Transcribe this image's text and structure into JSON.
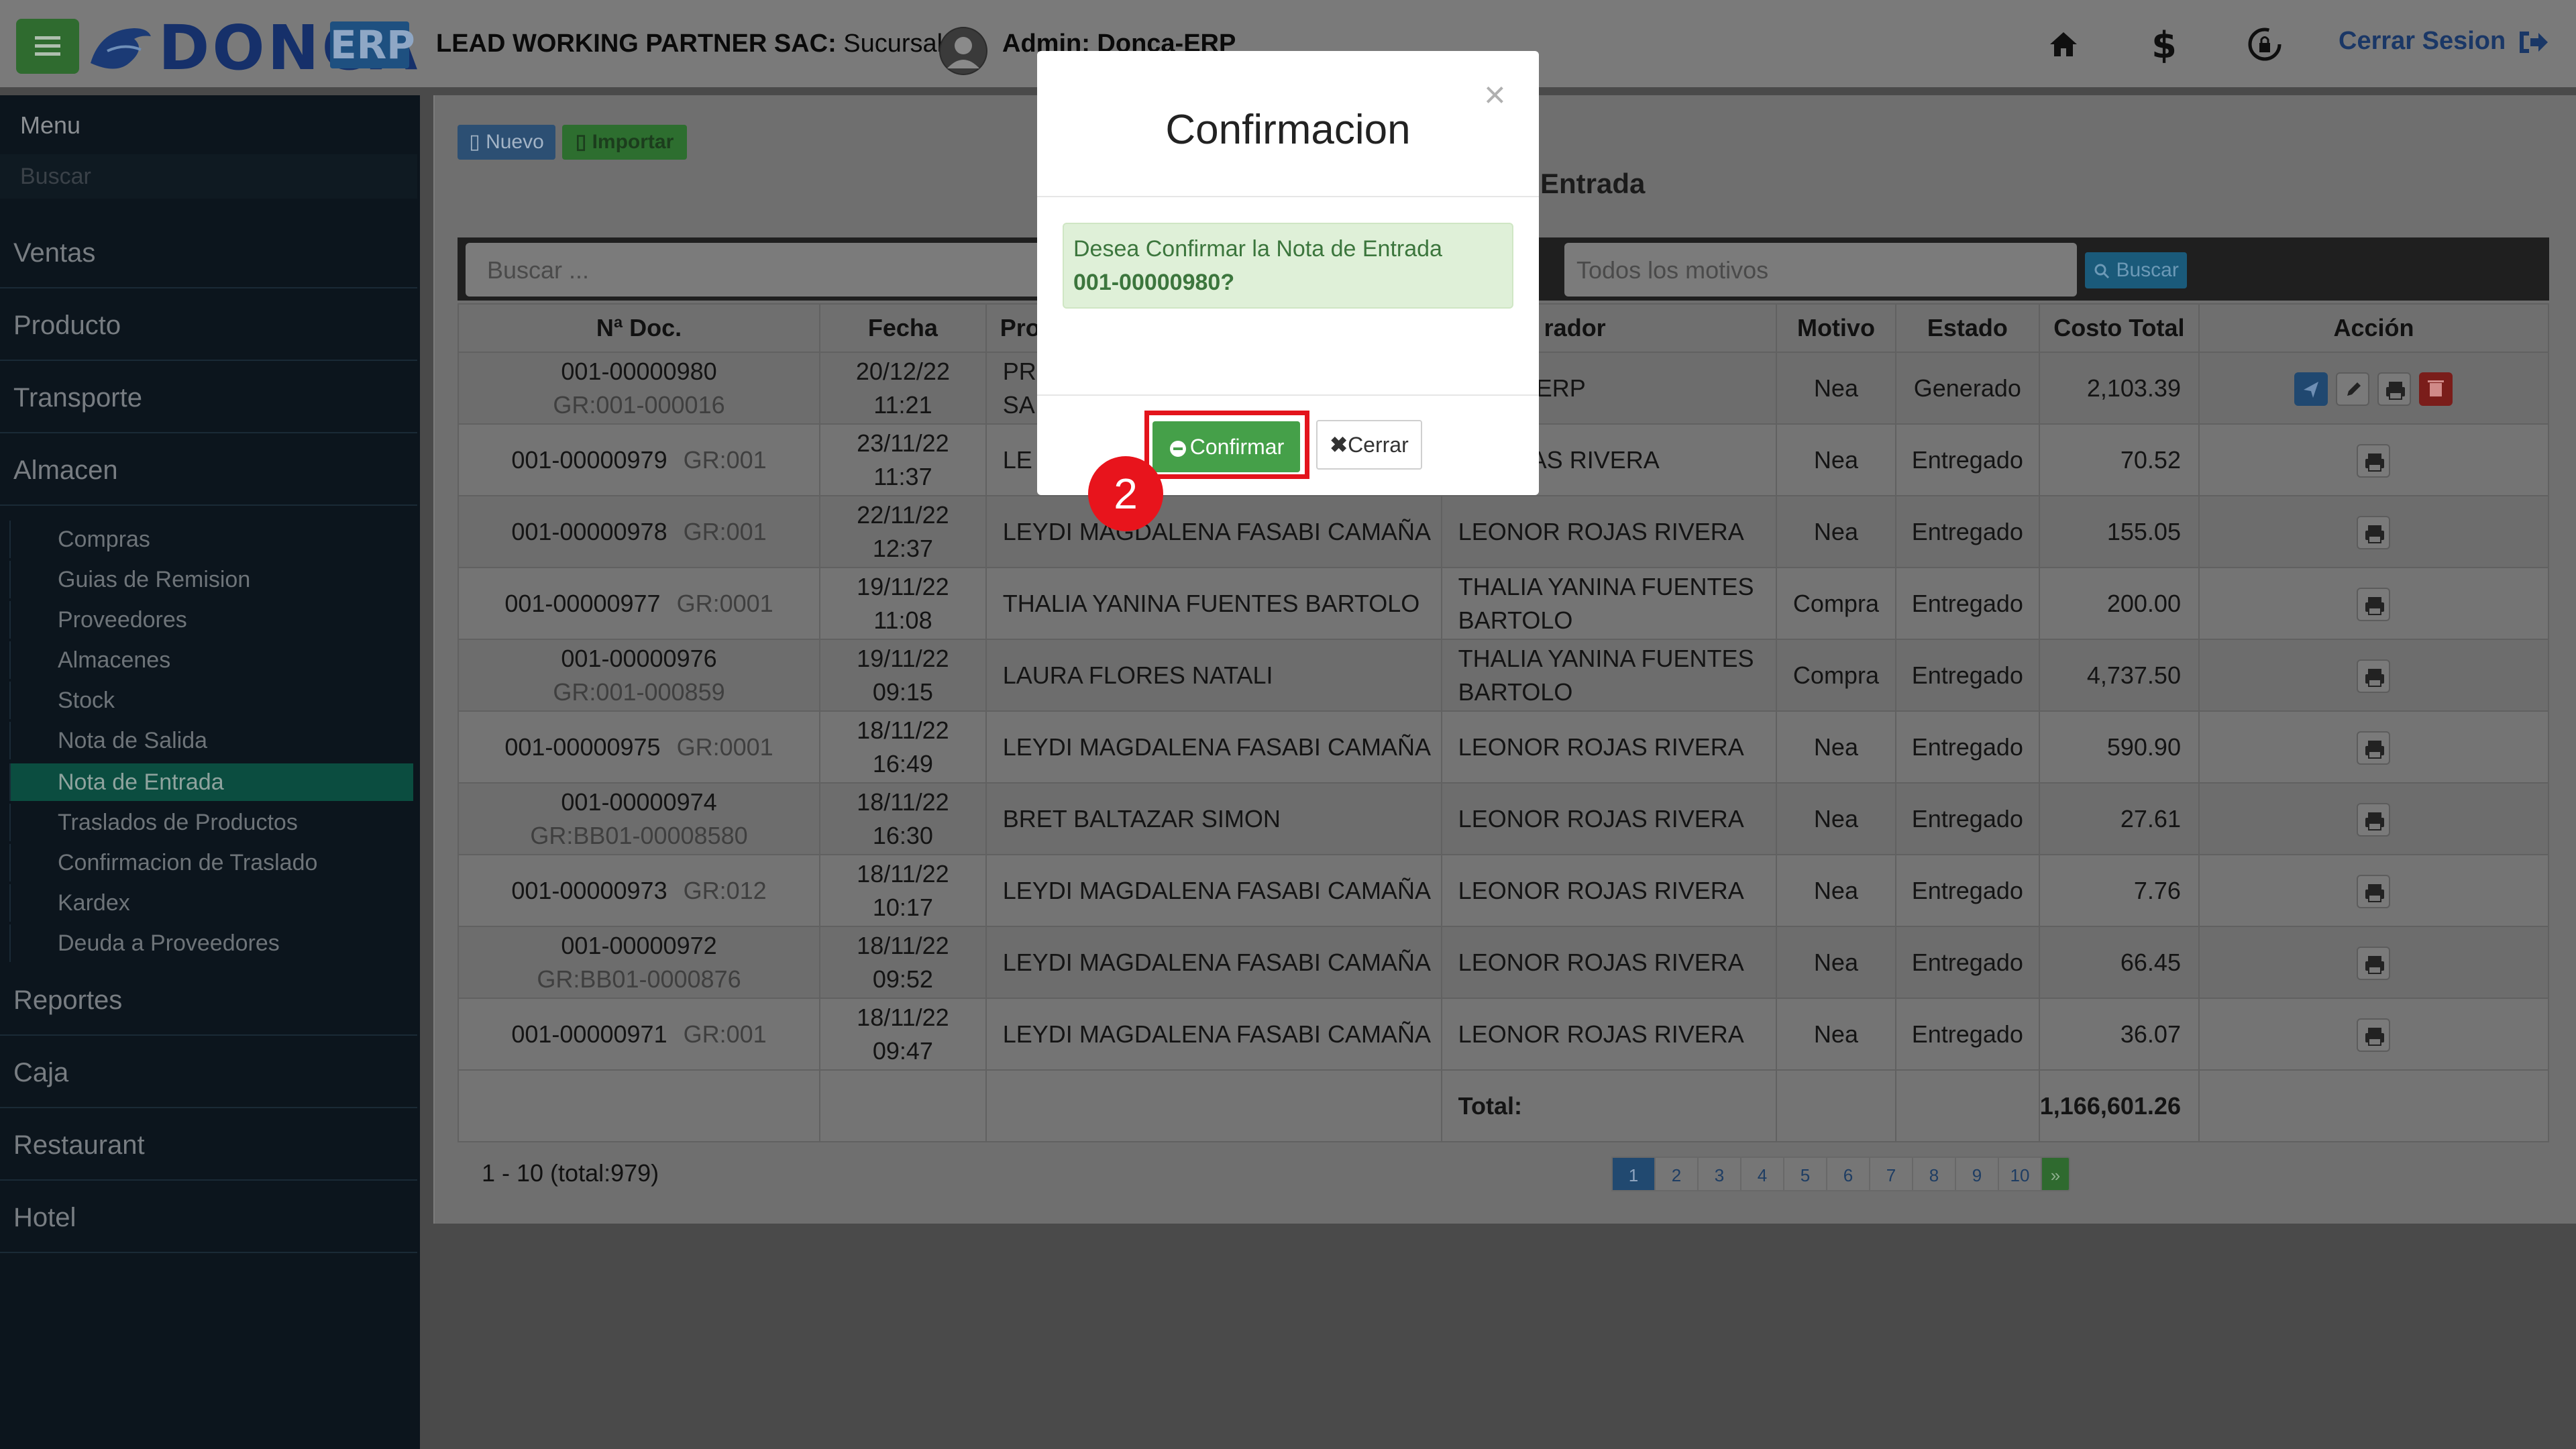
{
  "header": {
    "logo_text": "DONCA",
    "logo_badge": "ERP",
    "company_name": "LEAD WORKING PARTNER SAC:",
    "branch": " Sucursal k | ",
    "admin": "Admin: Donca-ERP",
    "logout": "Cerrar Sesion",
    "icons": [
      "home-icon",
      "dollar-icon",
      "lock-refresh-icon",
      "logout-icon"
    ]
  },
  "sidebar": {
    "title": "Menu",
    "search_placeholder": "Buscar",
    "items": [
      "Ventas",
      "Producto",
      "Transporte",
      "Almacen",
      "Reportes",
      "Caja",
      "Restaurant",
      "Hotel"
    ],
    "almacen_sub": [
      "Compras",
      "Guias de Remision",
      "Proveedores",
      "Almacenes",
      "Stock",
      "Nota de Salida",
      "Nota de Entrada",
      "Traslados de Productos",
      "Confirmacion de Traslado",
      "Kardex",
      "Deuda a Proveedores"
    ],
    "active_sub": "Nota de Entrada"
  },
  "toolbar": {
    "nuevo": "Nuevo",
    "importar": "Importar",
    "title_fragment": "Entrada",
    "search_placeholder": "Buscar ...",
    "motivos_placeholder": "Todos los motivos",
    "buscar": "Buscar"
  },
  "table": {
    "headers": [
      "Nª Doc.",
      "Fecha",
      "Pro",
      "rador",
      "Motivo",
      "Estado",
      "Costo Total",
      "Acción"
    ],
    "rows": [
      {
        "doc": "001-00000980",
        "gr": "GR:001-000016",
        "date": "20/12/22",
        "time": "11:21",
        "prov": "PR",
        "prov2": "SA",
        "oper": "Donca-ERP",
        "oper2": "",
        "motivo": "Nea",
        "estado": "Generado",
        "total": "2,103.39"
      },
      {
        "doc": "001-00000979",
        "gr": "GR:001",
        "date": "23/11/22",
        "time": "11:37",
        "prov": "LE",
        "prov2": "",
        "oper": "R ROJAS RIVERA",
        "oper2": "",
        "motivo": "Nea",
        "estado": "Entregado",
        "total": "70.52"
      },
      {
        "doc": "001-00000978",
        "gr": "GR:001",
        "date": "22/11/22",
        "time": "12:37",
        "prov": "LEYDI MAGDALENA FASABI CAMAÑA",
        "prov2": "",
        "oper": "LEONOR ROJAS RIVERA",
        "oper2": "",
        "motivo": "Nea",
        "estado": "Entregado",
        "total": "155.05"
      },
      {
        "doc": "001-00000977",
        "gr": "GR:0001",
        "date": "19/11/22",
        "time": "11:08",
        "prov": "THALIA YANINA FUENTES BARTOLO",
        "prov2": "",
        "oper": "THALIA YANINA FUENTES",
        "oper2": "BARTOLO",
        "motivo": "Compra",
        "estado": "Entregado",
        "total": "200.00"
      },
      {
        "doc": "001-00000976",
        "gr": "GR:001-000859",
        "date": "19/11/22",
        "time": "09:15",
        "prov": "LAURA FLORES NATALI",
        "prov2": "",
        "oper": "THALIA YANINA FUENTES",
        "oper2": "BARTOLO",
        "motivo": "Compra",
        "estado": "Entregado",
        "total": "4,737.50"
      },
      {
        "doc": "001-00000975",
        "gr": "GR:0001",
        "date": "18/11/22",
        "time": "16:49",
        "prov": "LEYDI MAGDALENA FASABI CAMAÑA",
        "prov2": "",
        "oper": "LEONOR ROJAS RIVERA",
        "oper2": "",
        "motivo": "Nea",
        "estado": "Entregado",
        "total": "590.90"
      },
      {
        "doc": "001-00000974",
        "gr": "GR:BB01-00008580",
        "date": "18/11/22",
        "time": "16:30",
        "prov": "BRET BALTAZAR SIMON",
        "prov2": "",
        "oper": "LEONOR ROJAS RIVERA",
        "oper2": "",
        "motivo": "Nea",
        "estado": "Entregado",
        "total": "27.61"
      },
      {
        "doc": "001-00000973",
        "gr": "GR:012",
        "date": "18/11/22",
        "time": "10:17",
        "prov": "LEYDI MAGDALENA FASABI CAMAÑA",
        "prov2": "",
        "oper": "LEONOR ROJAS RIVERA",
        "oper2": "",
        "motivo": "Nea",
        "estado": "Entregado",
        "total": "7.76"
      },
      {
        "doc": "001-00000972",
        "gr": "GR:BB01-0000876",
        "date": "18/11/22",
        "time": "09:52",
        "prov": "LEYDI MAGDALENA FASABI CAMAÑA",
        "prov2": "",
        "oper": "LEONOR ROJAS RIVERA",
        "oper2": "",
        "motivo": "Nea",
        "estado": "Entregado",
        "total": "66.45"
      },
      {
        "doc": "001-00000971",
        "gr": "GR:001",
        "date": "18/11/22",
        "time": "09:47",
        "prov": "LEYDI MAGDALENA FASABI CAMAÑA",
        "prov2": "",
        "oper": "LEONOR ROJAS RIVERA",
        "oper2": "",
        "motivo": "Nea",
        "estado": "Entregado",
        "total": "36.07"
      }
    ],
    "total_label": "Total:",
    "total_value": "1,166,601.26"
  },
  "pagination": {
    "info": "1 - 10 (total:979)",
    "pages": [
      "1",
      "2",
      "3",
      "4",
      "5",
      "6",
      "7",
      "8",
      "9",
      "10"
    ],
    "next": "»"
  },
  "modal": {
    "close": "×",
    "title": "Confirmacion",
    "message": "Desea Confirmar la Nota de Entrada",
    "doc": "001-00000980?",
    "confirm": "Confirmar",
    "close_btn": "Cerrar"
  },
  "step_marker": "2",
  "colors": {
    "confirm_green": "#45a049",
    "highlight_red": "#e3141c",
    "active_menu": "#0b4d40"
  }
}
